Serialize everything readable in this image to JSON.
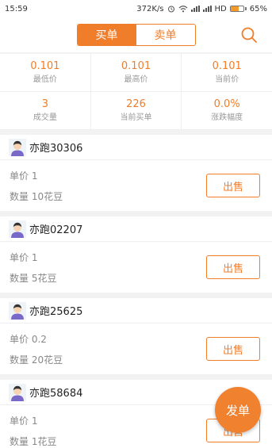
{
  "status": {
    "time": "15:59",
    "speed": "372K/s",
    "network": "HD",
    "battery": "65%",
    "battery_level": 0.65
  },
  "header": {
    "tab_buy": "买单",
    "tab_sell": "卖单",
    "active_tab": "buy"
  },
  "stats": [
    {
      "value": "0.101",
      "label": "最低价"
    },
    {
      "value": "0.101",
      "label": "最高价"
    },
    {
      "value": "0.101",
      "label": "当前价"
    },
    {
      "value": "3",
      "label": "成交量"
    },
    {
      "value": "226",
      "label": "当前买单"
    },
    {
      "value": "0.0%",
      "label": "涨跌幅度"
    }
  ],
  "orders": [
    {
      "user": "亦跑30306",
      "price": "单价 1",
      "quantity": "数量 10花豆",
      "action": "出售"
    },
    {
      "user": "亦跑02207",
      "price": "单价 1",
      "quantity": "数量 5花豆",
      "action": "出售"
    },
    {
      "user": "亦跑25625",
      "price": "单价 0.2",
      "quantity": "数量 20花豆",
      "action": "出售"
    },
    {
      "user": "亦跑58684",
      "price": "单价 1",
      "quantity": "数量 1花豆",
      "action": "出售"
    }
  ],
  "fab": {
    "label": "发单"
  },
  "colors": {
    "accent": "#f07d2a",
    "label": "#999999"
  }
}
